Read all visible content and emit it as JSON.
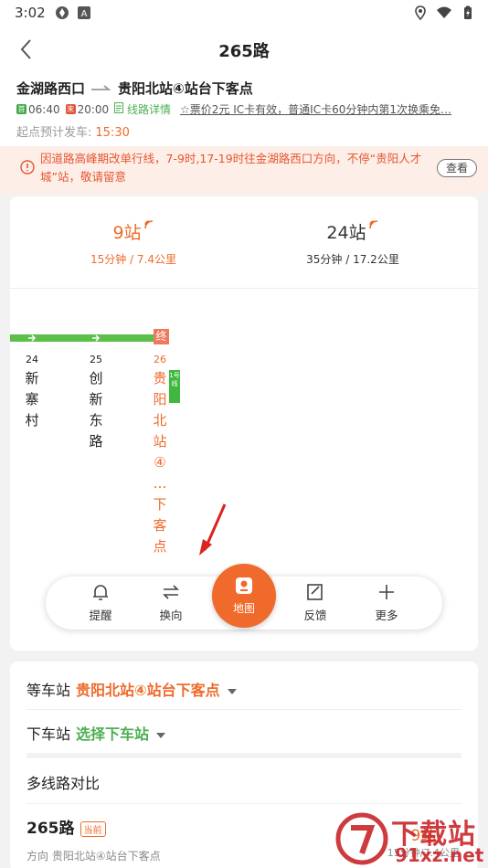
{
  "statusbar": {
    "time": "3:02"
  },
  "header": {
    "title": "265路"
  },
  "route": {
    "from": "金湖路西口",
    "to": "贵阳北站④站台下客点",
    "first_tag": "首",
    "first_time": "06:40",
    "last_tag": "末",
    "last_time": "20:00",
    "detail_link": "线路详情",
    "fare": "☆票价2元 IC卡有效，普通IC卡60分钟内第1次换乘免…",
    "depart_label": "起点预计发车:",
    "depart_time": "15:30"
  },
  "notice": {
    "text": "因道路高峰期改单行线，7-9时,17-19时往金湖路西口方向，不停“贵阳人才城”站，敬请留意",
    "button": "查看"
  },
  "arrivals": [
    {
      "stops": "9站",
      "detail": "15分钟 / 7.4公里"
    },
    {
      "stops": "24站",
      "detail": "35分钟 / 17.2公里"
    }
  ],
  "line": {
    "terminus": "终",
    "metro": "1号线",
    "stops": [
      {
        "num": "24",
        "name": [
          "新",
          "寨",
          "村"
        ]
      },
      {
        "num": "25",
        "name": [
          "创",
          "新",
          "东",
          "路"
        ]
      },
      {
        "num": "26",
        "name": [
          "贵",
          "阳",
          "北",
          "站",
          "④",
          "…",
          "下",
          "客",
          "点"
        ]
      }
    ]
  },
  "toolbar": {
    "remind": "提醒",
    "switch": "换向",
    "map": "地图",
    "feedback": "反馈",
    "more": "更多"
  },
  "board": {
    "wait_label": "等车站",
    "wait_value": "贵阳北站④站台下客点",
    "alight_label": "下车站",
    "alight_value": "选择下车站",
    "compare": "多线路对比",
    "route_name": "265路",
    "current_badge": "当前",
    "direction": "方向 贵阳北站④站台下客点",
    "next_stops": "9站",
    "next_detail": "15分钟/7.4公里"
  },
  "watermark": {
    "brand": "下载站",
    "domain": "91xz.net"
  },
  "colors": {
    "accent": "#ef6a2a",
    "green": "#4caf50",
    "track": "#5bbf4a"
  }
}
